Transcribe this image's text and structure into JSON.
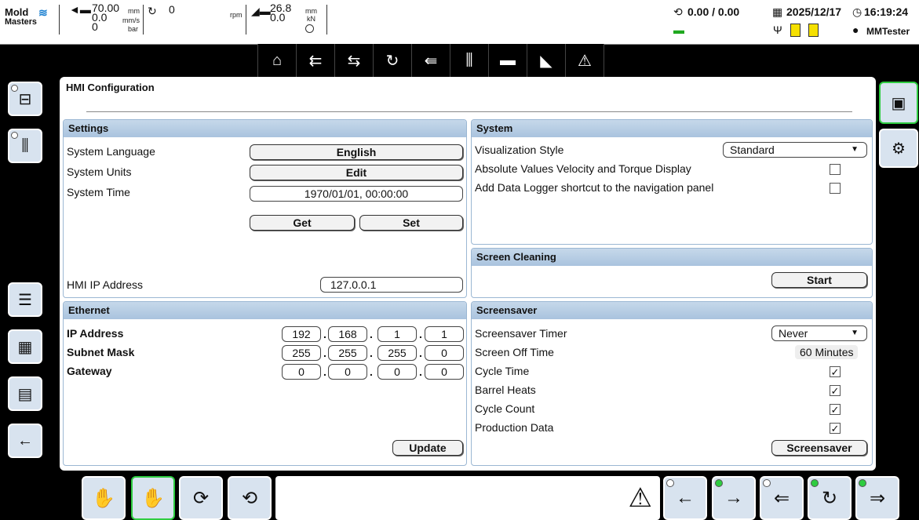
{
  "header": {
    "logo_line1": "Mold",
    "logo_line2": "Masters",
    "inj_value1": "70.00",
    "inj_value2": "0.0",
    "inj_value3": "0",
    "unit_mm": "mm",
    "unit_mms": "mm/s",
    "unit_bar": "bar",
    "screw_value": "0",
    "unit_rpm": "rpm",
    "clamp_value1": "26.8",
    "clamp_value2": "0.0",
    "unit_mm2": "mm",
    "unit_kn": "kN",
    "counter": "0.00 / 0.00",
    "date": "2025/12/17",
    "time": "16:19:24",
    "user": "MMTester"
  },
  "navbar": {
    "items": [
      "home-icon",
      "injection-icon",
      "hold-icon",
      "screw-recovery-icon",
      "nozzle-icon",
      "heater-icon",
      "mold-icon",
      "chart-icon",
      "alarm-icon"
    ],
    "glyphs": [
      "⌂",
      "⇇",
      "⇆",
      "↻",
      "⇚",
      "⫼",
      "▬",
      "◣",
      "⚠"
    ]
  },
  "panel": {
    "title": "HMI Configuration",
    "settings": {
      "header": "Settings",
      "language_label": "System Language",
      "language_value": "English",
      "units_label": "System Units",
      "units_button": "Edit",
      "time_label": "System Time",
      "time_value": "1970/01/01, 00:00:00",
      "get_button": "Get",
      "set_button": "Set",
      "ip_label": "HMI IP Address",
      "ip_value": "127.0.0.1"
    },
    "system": {
      "header": "System",
      "vis_label": "Visualization Style",
      "vis_value": "Standard",
      "abs_label": "Absolute Values Velocity and Torque Display",
      "abs_checked": false,
      "logger_label": "Add Data Logger shortcut to the navigation panel",
      "logger_checked": false
    },
    "cleaning": {
      "header": "Screen Cleaning",
      "start_button": "Start"
    },
    "ethernet": {
      "header": "Ethernet",
      "ip_label": "IP Address",
      "ip": [
        "192",
        "168",
        "1",
        "1"
      ],
      "subnet_label": "Subnet Mask",
      "subnet": [
        "255",
        "255",
        "255",
        "0"
      ],
      "gateway_label": "Gateway",
      "gateway": [
        "0",
        "0",
        "0",
        "0"
      ],
      "update_button": "Update"
    },
    "screensaver": {
      "header": "Screensaver",
      "timer_label": "Screensaver Timer",
      "timer_value": "Never",
      "off_label": "Screen Off Time",
      "off_value": "60 Minutes",
      "cycle_time_label": "Cycle Time",
      "barrel_label": "Barrel Heats",
      "cycle_count_label": "Cycle Count",
      "production_label": "Production Data",
      "check_mark": "✓",
      "screensaver_button": "Screensaver"
    }
  },
  "colors": {
    "accent": "#2ecc40",
    "panel_header": "#b5cde4",
    "button_bg": "#d8e3ef"
  }
}
